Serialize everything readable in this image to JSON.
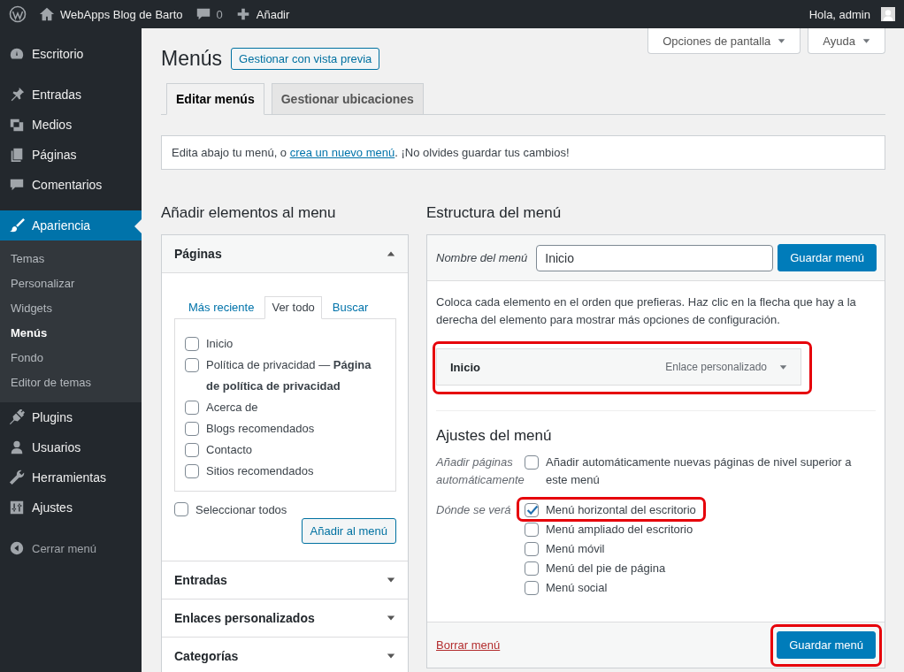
{
  "admin_bar": {
    "site_name": "WebApps Blog de Barto",
    "comments": "0",
    "new": "Añadir",
    "greeting": "Hola, admin"
  },
  "sidebar": {
    "groups": [
      [
        {
          "label": "Escritorio",
          "selected": false
        }
      ],
      [
        {
          "label": "Entradas",
          "selected": false
        },
        {
          "label": "Medios",
          "selected": false
        },
        {
          "label": "Páginas",
          "selected": false
        },
        {
          "label": "Comentarios",
          "selected": false
        }
      ],
      [
        {
          "label": "Apariencia",
          "selected": true,
          "children": [
            {
              "label": "Temas",
              "selected": false
            },
            {
              "label": "Personalizar",
              "selected": false
            },
            {
              "label": "Widgets",
              "selected": false
            },
            {
              "label": "Menús",
              "selected": true
            },
            {
              "label": "Fondo",
              "selected": false
            },
            {
              "label": "Editor de temas",
              "selected": false
            }
          ]
        },
        {
          "label": "Plugins",
          "selected": false
        },
        {
          "label": "Usuarios",
          "selected": false
        },
        {
          "label": "Herramientas",
          "selected": false
        },
        {
          "label": "Ajustes",
          "selected": false
        }
      ]
    ],
    "collapse": "Cerrar menú"
  },
  "screen_meta": [
    {
      "label": "Opciones de pantalla"
    },
    {
      "label": "Ayuda"
    }
  ],
  "title": "Menús",
  "preview_button": "Gestionar con vista previa",
  "tabs": [
    {
      "label": "Editar menús",
      "selected": true
    },
    {
      "label": "Gestionar ubicaciones",
      "selected": false
    }
  ],
  "notice": {
    "before": "Edita abajo tu menú, o ",
    "link": "crea un nuevo menú",
    "after": ". ¡No olvides guardar tus cambios!"
  },
  "add_items": {
    "heading": "Añadir elementos al menu",
    "sections": [
      {
        "title": "Páginas",
        "expanded": true,
        "tabs": [
          {
            "label": "Más reciente",
            "selected": false
          },
          {
            "label": "Ver todo",
            "selected": true
          },
          {
            "label": "Buscar",
            "selected": false
          }
        ],
        "items": [
          {
            "label": "Inicio",
            "checked": false
          },
          {
            "label": "Política de privacidad — **Página de política de privacidad**",
            "checked": false
          },
          {
            "label": "Acerca de",
            "checked": false
          },
          {
            "label": "Blogs recomendados",
            "checked": false
          },
          {
            "label": "Contacto",
            "checked": false
          },
          {
            "label": "Sitios recomendados",
            "checked": false
          }
        ],
        "select_all": {
          "label": "Seleccionar todos",
          "checked": false
        },
        "button": "Añadir al menú"
      },
      {
        "title": "Entradas",
        "expanded": false
      },
      {
        "title": "Enlaces personalizados",
        "expanded": false
      },
      {
        "title": "Categorías",
        "expanded": false
      }
    ]
  },
  "menu_structure": {
    "heading": "Estructura del menú",
    "name_label": "Nombre del menú",
    "name_value": "Inicio",
    "save_button": {
      "label": "Guardar menú",
      "highlighted": false
    },
    "instructions": "Coloca cada elemento en el orden que prefieras. Haz clic en la flecha que hay a la derecha del elemento para mostrar más opciones de configuración.",
    "items": [
      {
        "title": "Inicio",
        "type": "Enlace personalizado",
        "highlighted": true
      }
    ],
    "settings_heading": "Ajustes del menú",
    "settings": [
      {
        "label": "Añadir páginas automáticamente",
        "options": [
          {
            "label": "Añadir automáticamente nuevas páginas de nivel superior a este menú",
            "checked": false,
            "highlighted": false
          }
        ]
      },
      {
        "label": "Dónde se verá",
        "options": [
          {
            "label": "Menú horizontal del escritorio",
            "checked": true,
            "highlighted": true
          },
          {
            "label": "Menú ampliado del escritorio",
            "checked": false,
            "highlighted": false
          },
          {
            "label": "Menú móvil",
            "checked": false,
            "highlighted": false
          },
          {
            "label": "Menú del pie de página",
            "checked": false,
            "highlighted": false
          },
          {
            "label": "Menú social",
            "checked": false,
            "highlighted": false
          }
        ]
      }
    ],
    "delete_link": "Borrar menú",
    "footer_save": {
      "label": "Guardar menú",
      "highlighted": true
    }
  }
}
